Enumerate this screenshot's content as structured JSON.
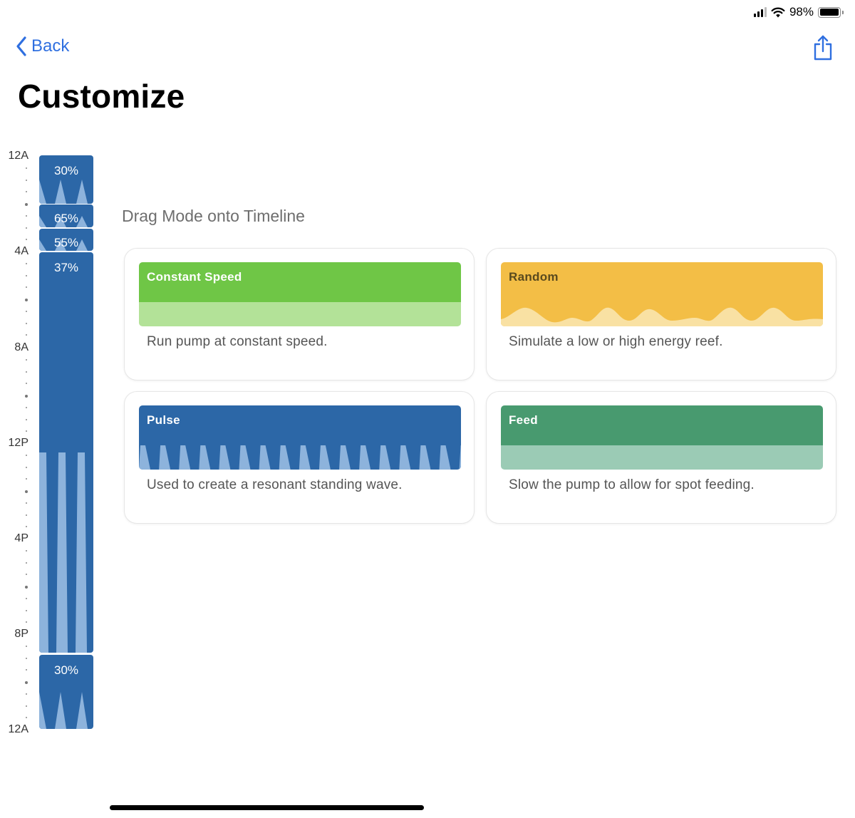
{
  "status_bar": {
    "battery_percent": "98%",
    "battery_level": 0.98
  },
  "nav": {
    "back_label": "Back",
    "title": "Customize"
  },
  "timeline": {
    "ticks": [
      "12A",
      "4A",
      "8A",
      "12P",
      "4P",
      "8P",
      "12A"
    ],
    "segments": [
      {
        "label": "30%",
        "pattern": "pulse"
      },
      {
        "label": "65%",
        "pattern": "pulse"
      },
      {
        "label": "55%",
        "pattern": "pulse"
      },
      {
        "label": "37%",
        "pattern": "pulse"
      },
      {
        "label": "30%",
        "pattern": "pulse"
      }
    ]
  },
  "modes": {
    "heading": "Drag Mode onto Timeline",
    "cards": [
      {
        "name": "Constant Speed",
        "description": "Run pump at constant speed.",
        "color": "#6fc646",
        "light_color": "#b3e298",
        "text_color": "#ffffff"
      },
      {
        "name": "Random",
        "description": "Simulate a low or high energy reef.",
        "color": "#f3be46",
        "light_color": "#f9e1a3",
        "text_color": "#5a4a1e"
      },
      {
        "name": "Pulse",
        "description": "Used to create a resonant standing wave.",
        "color": "#2c67a7",
        "light_color": "#8db3dc",
        "text_color": "#ffffff"
      },
      {
        "name": "Feed",
        "description": "Slow the pump to allow for spot feeding.",
        "color": "#489a6f",
        "light_color": "#9bcbb5",
        "text_color": "#ffffff"
      }
    ]
  },
  "icons": {
    "back": "chevron-left-icon",
    "share": "share-icon",
    "signal": "cellular-signal-icon",
    "wifi": "wifi-icon",
    "battery": "battery-icon"
  }
}
